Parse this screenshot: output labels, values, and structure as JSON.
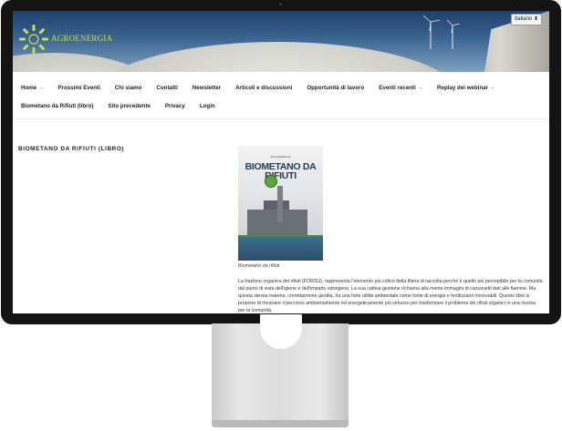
{
  "header": {
    "logo_text": "AGROENERGIA",
    "language": "Italiano",
    "language_arrows": "⬍"
  },
  "nav": {
    "row1": [
      {
        "label": "Home",
        "has_dropdown": true
      },
      {
        "label": "Prossimi Eventi",
        "has_dropdown": false
      },
      {
        "label": "Chi siamo",
        "has_dropdown": false
      },
      {
        "label": "Contatti",
        "has_dropdown": false
      },
      {
        "label": "Newsletter",
        "has_dropdown": false
      },
      {
        "label": "Articoli e discussioni",
        "has_dropdown": false
      },
      {
        "label": "Opportunità di lavoro",
        "has_dropdown": false
      },
      {
        "label": "Eventi recenti",
        "has_dropdown": true
      },
      {
        "label": "Replay dei webinar",
        "has_dropdown": true
      }
    ],
    "row2": [
      {
        "label": "Biometano da Rifiuti (libro)"
      },
      {
        "label": "Sito precedente"
      },
      {
        "label": "Privacy"
      },
      {
        "label": "Login"
      }
    ],
    "chevron": "⌄"
  },
  "page": {
    "title": "BIOMETANO DA RIFIUTI (LIBRO)",
    "book_author": "Piero Baldissera",
    "book_title_line1": "BIOMETANO DA",
    "book_title_line2": "RIFIUTI",
    "caption": "Biometano da rifiuti",
    "body": "La frazione organica dei rifiuti (FORSU), rappresenta l'elemento più critico della filiera di raccolta perché è quello più percepibile per la comunità dal punto di vista dell'igiene e dell'impatto odorigeno. La sua cattiva gestione richiama alla mente immagini di cassonetti dati alle fiamme. Ma questa stessa materia, correttamente gestita, ha una forte utilità ambientale come fonte di energia e fertilizzanti rinnovabili. Questo libro si propone di mostrare il percorso ambientalmente ed energeticamente più virtuoso per trasformare il problema dei rifiuti organici in una risorsa per la comunità."
  },
  "colors": {
    "logo_accent": "#c8e04a",
    "nav_text": "#222222",
    "monitor_bezel": "#141414"
  }
}
